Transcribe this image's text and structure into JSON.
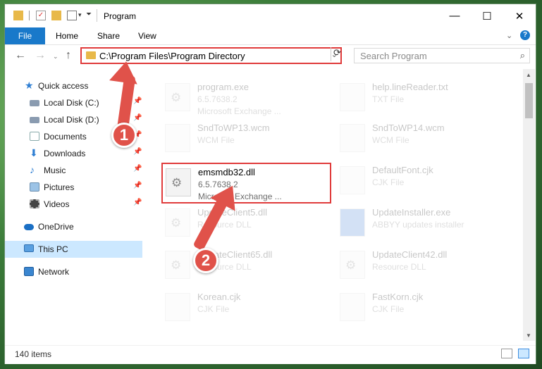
{
  "window": {
    "title": "Program"
  },
  "ribbon": {
    "file": "File",
    "home": "Home",
    "share": "Share",
    "view": "View"
  },
  "address": {
    "path": "C:\\Program Files\\Program Directory"
  },
  "search": {
    "placeholder": "Search Program"
  },
  "nav": {
    "quick_access": "Quick access",
    "local_c": "Local Disk (C:)",
    "local_d": "Local Disk (D:)",
    "documents": "Documents",
    "downloads": "Downloads",
    "music": "Music",
    "pictures": "Pictures",
    "videos": "Videos",
    "onedrive": "OneDrive",
    "this_pc": "This PC",
    "network": "Network"
  },
  "files": {
    "program_exe": {
      "name": "program.exe",
      "line1": "6.5.7638.2",
      "line2": "Microsoft Exchange ..."
    },
    "help_txt": {
      "name": "help.lineReader.txt",
      "line1": "TXT File"
    },
    "sndwp13": {
      "name": "SndToWP13.wcm",
      "line1": "WCM File"
    },
    "sndwp14": {
      "name": "SndToWP14.wcm",
      "line1": "WCM File"
    },
    "emsmdb": {
      "name": "emsmdb32.dll",
      "line1": "6.5.7638.2",
      "line2": "Microsoft Exchange ..."
    },
    "defaultfont": {
      "name": "DefaultFont.cjk",
      "line1": "CJK File"
    },
    "updateclient5": {
      "name": "UpdateClient5.dll",
      "line1": "Resource DLL"
    },
    "updateinstaller": {
      "name": "UpdateInstaller.exe",
      "line1": "ABBYY updates installer"
    },
    "updateclient65": {
      "name": "UpdateClient65.dll",
      "line1": "Resource DLL"
    },
    "updateclient42": {
      "name": "UpdateClient42.dll",
      "line1": "Resource DLL"
    },
    "korean": {
      "name": "Korean.cjk",
      "line1": "CJK File"
    },
    "fastkorn": {
      "name": "FastKorn.cjk",
      "line1": "CJK File"
    }
  },
  "status": {
    "count": "140 items"
  },
  "annotations": {
    "step1": "1",
    "step2": "2"
  },
  "colors": {
    "accent": "#1979ca",
    "highlight": "#e03b3b",
    "arrow": "#e0524a",
    "selected": "#cce8ff"
  }
}
